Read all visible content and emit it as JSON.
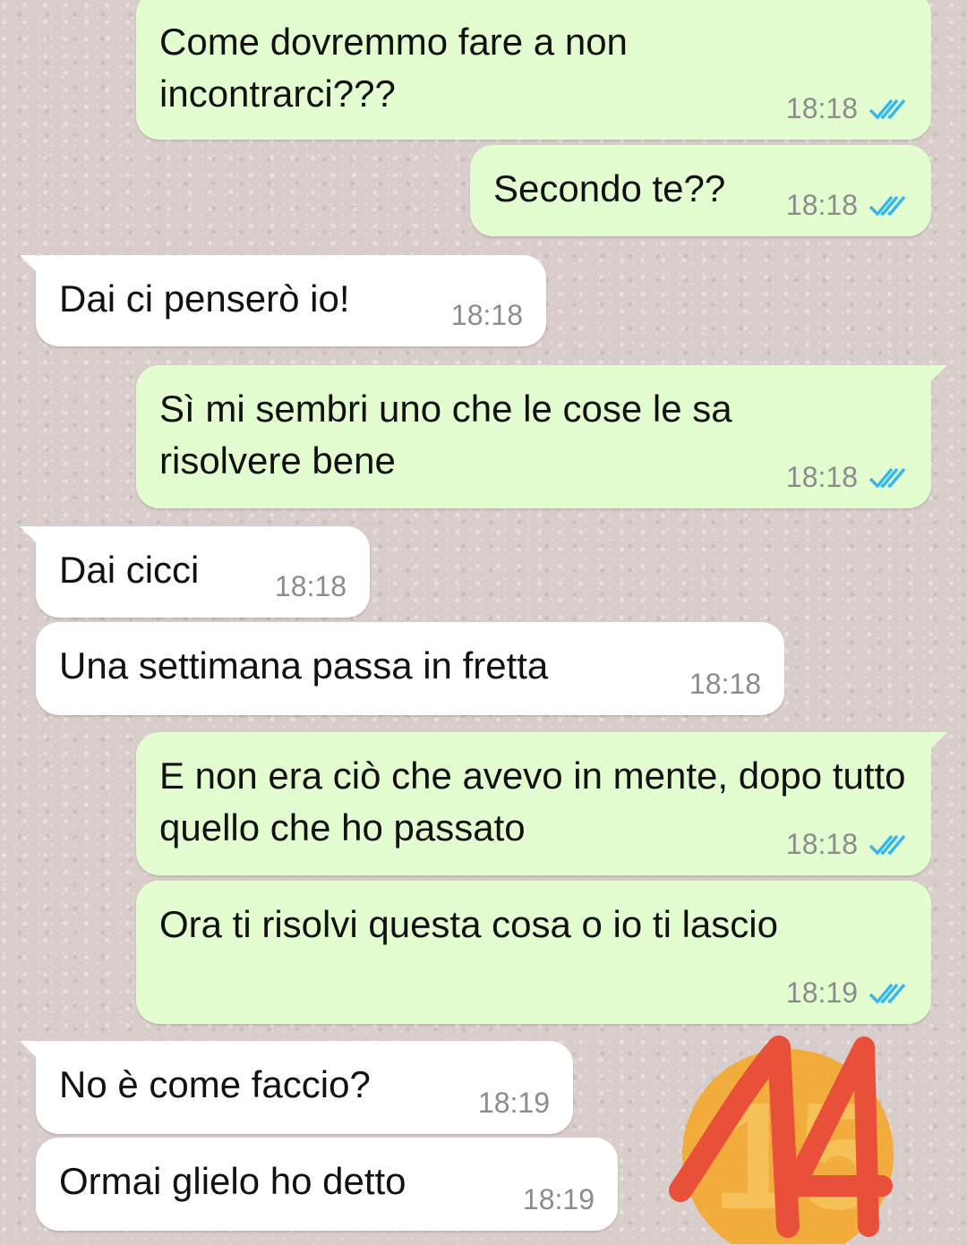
{
  "messages": [
    {
      "direction": "out",
      "text": "Come dovremmo fare a non incontrarci???",
      "time": "18:18",
      "status": "read"
    },
    {
      "direction": "out",
      "text": "Secondo te??",
      "time": "18:18",
      "status": "read"
    },
    {
      "direction": "in",
      "text": "Dai ci penserò io!",
      "time": "18:18"
    },
    {
      "direction": "out",
      "text": "Sì mi sembri uno che le cose le sa risolvere bene",
      "time": "18:18",
      "status": "read"
    },
    {
      "direction": "in",
      "text": "Dai cicci",
      "time": "18:18"
    },
    {
      "direction": "in",
      "text": "Una settimana passa in fretta",
      "time": "18:18"
    },
    {
      "direction": "out",
      "text": "E non era ciò che avevo in mente, dopo tutto quello che ho passato",
      "time": "18:18",
      "status": "read"
    },
    {
      "direction": "out",
      "text": "Ora ti risolvi questa cosa o io ti lascio",
      "time": "18:19",
      "status": "read"
    },
    {
      "direction": "in",
      "text": "No è come faccio?",
      "time": "18:19"
    },
    {
      "direction": "in",
      "text": "Ormai glielo ho detto",
      "time": "18:19"
    }
  ],
  "overlay": {
    "handwritten_number": "14",
    "background_number": "15"
  },
  "colors": {
    "outgoing_bubble": "#e3fdd0",
    "incoming_bubble": "#ffffff",
    "read_ticks": "#34b7f1",
    "marker": "#e8503a",
    "emoji_circle": "#f5a623"
  },
  "icons": {
    "read_receipt": "double-check-icon"
  }
}
